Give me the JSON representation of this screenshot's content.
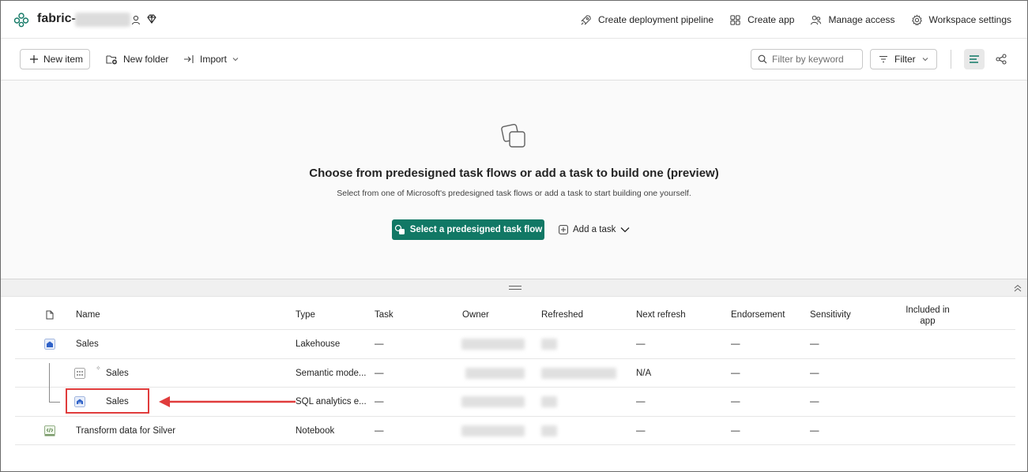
{
  "header": {
    "workspace_name": "fabric-",
    "actions": [
      {
        "label": "Create deployment pipeline",
        "icon": "rocket-icon"
      },
      {
        "label": "Create app",
        "icon": "apps-icon"
      },
      {
        "label": "Manage access",
        "icon": "people-icon"
      },
      {
        "label": "Workspace settings",
        "icon": "gear-icon"
      }
    ]
  },
  "toolbar": {
    "new_item": "New item",
    "new_folder": "New folder",
    "import": "Import",
    "search_placeholder": "Filter by keyword",
    "filter": "Filter"
  },
  "taskflow": {
    "title": "Choose from predesigned task flows or add a task to build one (preview)",
    "subtitle": "Select from one of Microsoft's predesigned task flows or add a task to start building one yourself.",
    "primary_button": "Select a predesigned task flow",
    "add_task": "Add a task"
  },
  "table": {
    "columns": {
      "name": "Name",
      "type": "Type",
      "task": "Task",
      "owner": "Owner",
      "refreshed": "Refreshed",
      "next_refresh": "Next refresh",
      "endorsement": "Endorsement",
      "sensitivity": "Sensitivity",
      "included_in_app_1": "Included in",
      "included_in_app_2": "app"
    },
    "rows": [
      {
        "name": "Sales",
        "type": "Lakehouse",
        "task": "—",
        "next_refresh": "—",
        "endorsement": "—",
        "sensitivity": "—",
        "icon": "lakehouse-icon"
      },
      {
        "name": "Sales",
        "type": "Semantic mode...",
        "task": "—",
        "next_refresh": "N/A",
        "endorsement": "—",
        "sensitivity": "—",
        "icon": "semantic-model-icon"
      },
      {
        "name": "Sales",
        "type": "SQL analytics e...",
        "task": "—",
        "next_refresh": "—",
        "endorsement": "—",
        "sensitivity": "—",
        "icon": "sql-endpoint-icon"
      },
      {
        "name": "Transform data for Silver",
        "type": "Notebook",
        "task": "—",
        "next_refresh": "—",
        "endorsement": "—",
        "sensitivity": "—",
        "icon": "notebook-icon"
      }
    ]
  },
  "colors": {
    "primary": "#117865",
    "annotation": "#e03c3c"
  }
}
